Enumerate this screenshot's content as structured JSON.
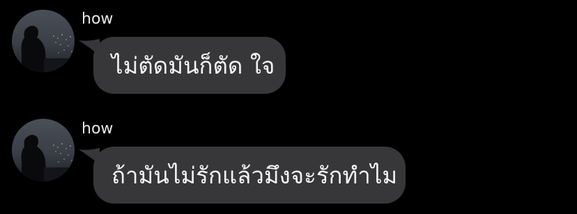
{
  "messages": [
    {
      "sender": "how",
      "text": "ไม่ตัดมันก็ตัด ใจ",
      "avatar_icon": "profile-photo-silhouette"
    },
    {
      "sender": "how",
      "text": "ถ้ามันไม่รักแล้วมึงจะรักทำไม",
      "avatar_icon": "profile-photo-silhouette"
    }
  ],
  "colors": {
    "background": "#000000",
    "bubble": "#37373a",
    "text": "#f2f2f2"
  }
}
